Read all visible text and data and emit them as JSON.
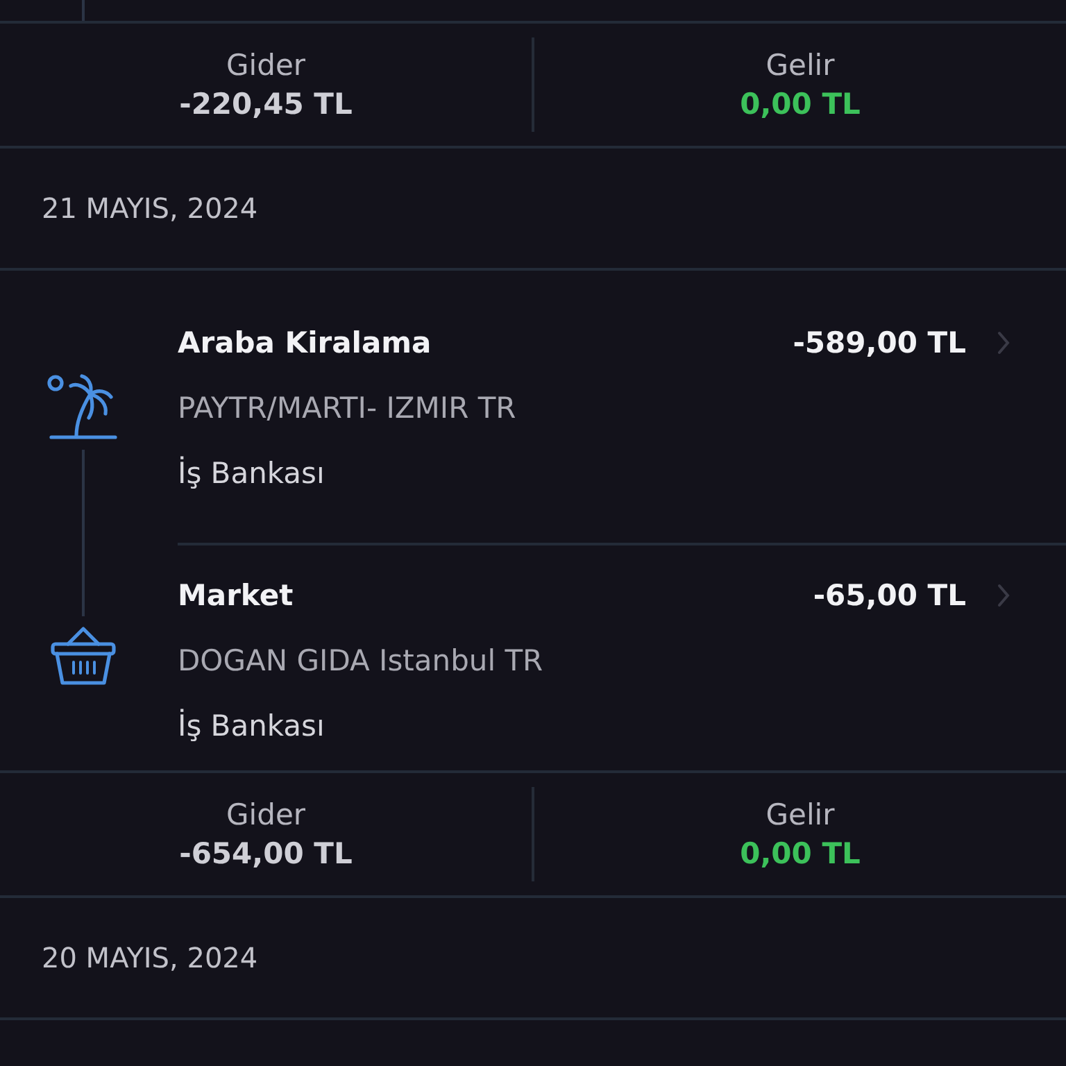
{
  "sections": [
    {
      "kind": "timeline_end"
    },
    {
      "kind": "summary",
      "items": [
        {
          "kind": "expense",
          "label": "Gider",
          "amount": "-220,45 TL"
        },
        {
          "kind": "income",
          "label": "Gelir",
          "amount": "0,00 TL"
        }
      ]
    },
    {
      "kind": "date",
      "text": "21 MAYIS, 2024"
    },
    {
      "kind": "transactions",
      "items": [
        {
          "kind": "travel",
          "title": "Araba Kiralama",
          "merchant": "PAYTR/MARTI- IZMIR TR",
          "account": "İş Bankası",
          "amount": "-589,00 TL"
        },
        {
          "kind": "groceries",
          "title": "Market",
          "merchant": "DOGAN GIDA Istanbul TR",
          "account": "İş Bankası",
          "amount": "-65,00 TL"
        }
      ]
    },
    {
      "kind": "summary",
      "items": [
        {
          "kind": "expense",
          "label": "Gider",
          "amount": "-654,00 TL"
        },
        {
          "kind": "income",
          "label": "Gelir",
          "amount": "0,00 TL"
        }
      ]
    },
    {
      "kind": "date",
      "text": "20 MAYIS, 2024"
    }
  ]
}
